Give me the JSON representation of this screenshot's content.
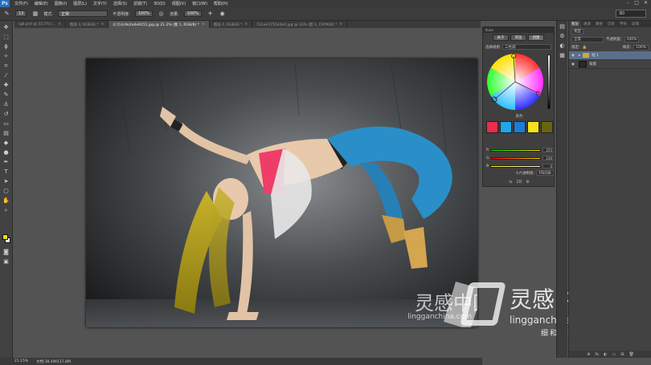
{
  "menubar": {
    "logo": "Ps",
    "items": [
      "文件(F)",
      "编辑(E)",
      "图像(I)",
      "图层(L)",
      "文字(Y)",
      "选择(S)",
      "滤镜(T)",
      "3D(D)",
      "视图(V)",
      "窗口(W)",
      "帮助(H)"
    ],
    "window_controls": [
      "–",
      "□",
      "✕"
    ]
  },
  "options": {
    "mode_label": "模式:",
    "mode_value": "正常",
    "opacity_label": "不透明度:",
    "opacity_value": "100%",
    "flow_label": "流量:",
    "flow_value": "100%",
    "brush_size": "13",
    "workspace": "3D"
  },
  "tabs": [
    {
      "label": "rgb.psd @ 33.1% (...",
      "active": false
    },
    {
      "label": "图层 4, RGB/8) *",
      "active": false
    },
    {
      "label": "(C)53c9e2e4e8151.jpg @ 21.2% (图 1, RGB/8) *",
      "active": true
    },
    {
      "label": "图层 4, RGB/8) *",
      "active": false
    },
    {
      "label": "531ee57554de0.jpg @ 33% (图 1, CMYK/8) *",
      "active": false
    }
  ],
  "status": {
    "zoom": "21.15%",
    "doc": "文档:38.4M/117.8M"
  },
  "color_panel": {
    "header": "Kuler",
    "tabs": [
      "关于",
      "浏览",
      "创建"
    ],
    "active_tab": 2,
    "rule_label": "选择规则",
    "rule_value": "三色调",
    "basic_label": "基色",
    "swatches": [
      "#ef2b4e",
      "#1ea8e6",
      "#1d7dd6",
      "#f4e21a",
      "#6a6410"
    ],
    "sliders": [
      {
        "label": "R",
        "value": "255",
        "color": "linear-gradient(90deg,#00e000,#ffe000)"
      },
      {
        "label": "G",
        "value": "236",
        "color": "linear-gradient(90deg,#ff0000,#ffe000)"
      },
      {
        "label": "B",
        "value": "0",
        "color": "linear-gradient(90deg,#ffec00,#ffecff)"
      }
    ],
    "hex_label": "十六进制值:",
    "hex_value": "FFEC00",
    "footer_icons": [
      "⇆",
      "2D",
      "⚙"
    ]
  },
  "layers_panel": {
    "tabs": [
      "图层",
      "通道",
      "路径",
      "历史",
      "字符",
      "段落"
    ],
    "kind_label": "类型",
    "blend": "正常",
    "opacity_label": "不透明度:",
    "opacity_value": "100%",
    "lock_label": "锁定:",
    "fill_label": "填充:",
    "fill_value": "100%",
    "layers": [
      {
        "name": "组 1",
        "type": "group",
        "active": true
      },
      {
        "name": "背景",
        "type": "image",
        "active": false
      }
    ],
    "footer_icons": [
      "⊕",
      "fx",
      "◐",
      "▭",
      "⊞",
      "🗑"
    ]
  },
  "canvas": {
    "watermark_brand": "灵感中国",
    "watermark_url": "lingganchina.com",
    "watermark_tag": "细和摄影后期教程"
  },
  "foreground_color": "#f0e000",
  "background_color": "#ffffff"
}
